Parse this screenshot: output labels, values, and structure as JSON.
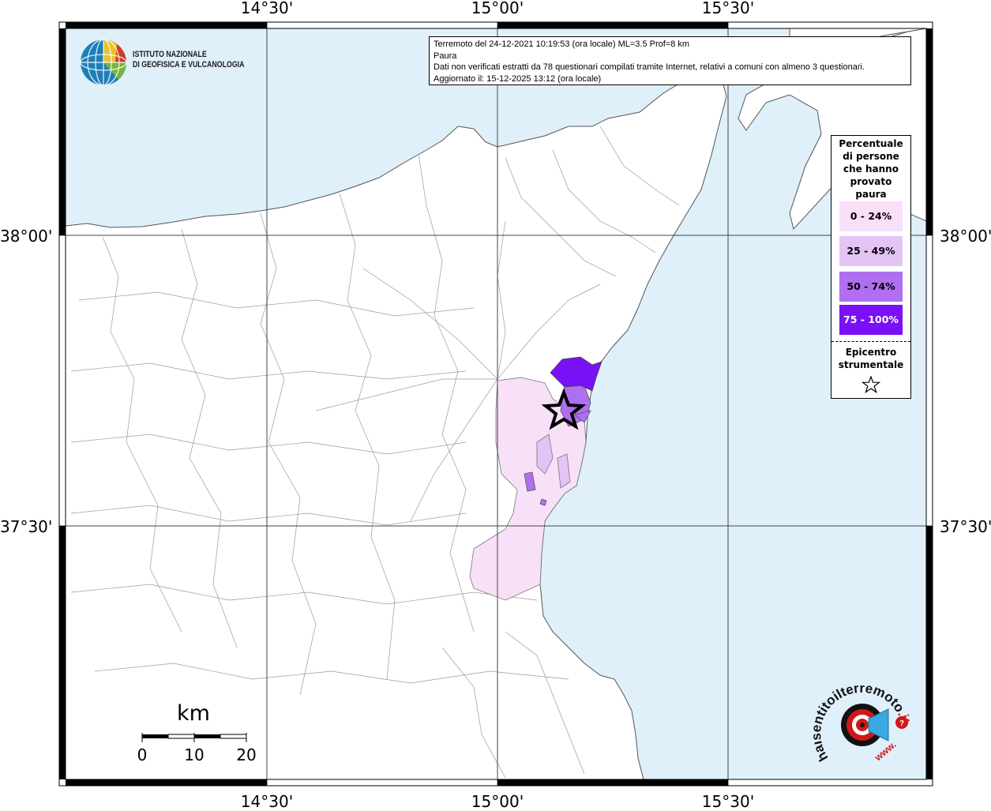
{
  "map": {
    "top_labels": [
      "14°30'",
      "15°00'",
      "15°30'"
    ],
    "bottom_labels": [
      "14°30'",
      "15°00'",
      "15°30'"
    ],
    "left_labels": [
      "38°00'",
      "37°30'"
    ],
    "right_labels": [
      "38°00'",
      "37°30'"
    ],
    "sea_color": "#dff0fb",
    "land_color": "#ffffff",
    "frame_color": "#000000"
  },
  "info": {
    "line1": "Terremoto del 24-12-2021 10:19:53 (ora locale) ML=3.5 Prof=8 km",
    "line2": "Paura",
    "line3": "Dati non verificati estratti da 78 questionari compilati tramite Internet, relativi a comuni con almeno 3 questionari.",
    "line4": "Aggiornato il: 15-12-2025 13:12 (ora locale)"
  },
  "legend": {
    "title_lines": [
      "Percentuale",
      "di persone",
      "che hanno",
      "provato",
      "paura"
    ],
    "classes": [
      {
        "label": "0 - 24%",
        "color": "#f7e0f8",
        "text_color": "#000000"
      },
      {
        "label": "25 - 49%",
        "color": "#e4c4f5",
        "text_color": "#000000"
      },
      {
        "label": "50 - 74%",
        "color": "#b06ff0",
        "text_color": "#000000"
      },
      {
        "label": "75 - 100%",
        "color": "#7a10f5",
        "text_color": "#ffffff"
      }
    ],
    "epicenter_lines": [
      "Epicentro",
      "strumentale"
    ],
    "epicenter_icon": "star-icon"
  },
  "ingv": {
    "line1": "ISTITUTO NAZIONALE",
    "line2": "DI GEOFISICA E VULCANOLOGIA",
    "logo_icon": "globe-logo-icon"
  },
  "scalebar": {
    "unit": "km",
    "ticks": [
      "0",
      "10",
      "20"
    ]
  },
  "hsit": {
    "text_main": "haisentitoilterremoto",
    "text_domain": ".it",
    "text_www": "www.",
    "logo_icon": "speaker-target-logo-icon"
  }
}
